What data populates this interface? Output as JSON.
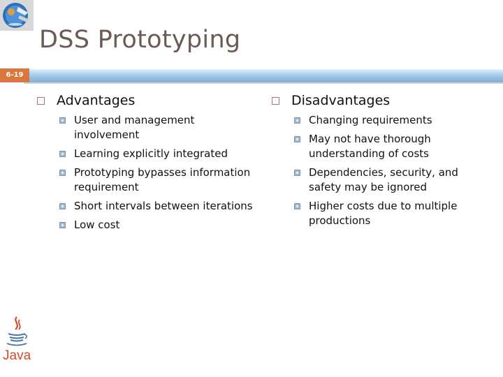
{
  "slide": {
    "title": "DSS Prototyping",
    "slide_number": "6-19",
    "footer_logo_text": "Java"
  },
  "left": {
    "heading": "Advantages",
    "items": [
      "User and management involvement",
      "Learning explicitly integrated",
      "Prototyping bypasses information requirement",
      "Short intervals between iterations",
      "Low cost"
    ]
  },
  "right": {
    "heading": "Disadvantages",
    "items": [
      "Changing requirements",
      "May not have thorough understanding of costs",
      "Dependencies, security, and safety may be ignored",
      "Higher costs due to multiple productions"
    ]
  },
  "colors": {
    "title": "#6b5a55",
    "slide_number_bg": "#d9773f",
    "bar": "#98bedf",
    "bullet": "#a4b8cb",
    "java_red": "#d14b2a",
    "java_blue": "#4a78a8"
  }
}
